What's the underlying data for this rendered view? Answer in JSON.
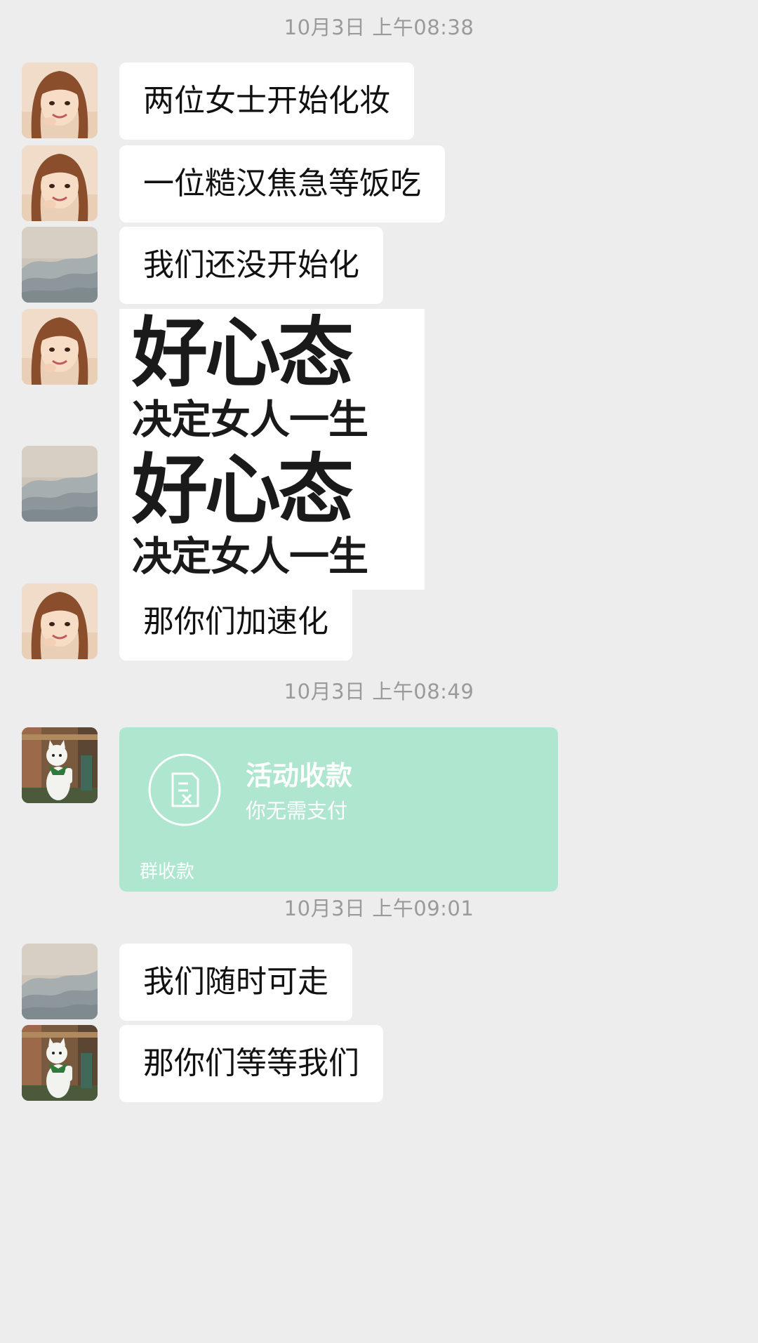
{
  "colors": {
    "background": "#ededed",
    "bubble": "#ffffff",
    "timestamp": "#9a9a9a",
    "payment_card": "#aee6cf"
  },
  "timestamps": [
    "10月3日 上午08:38",
    "10月3日 上午08:49",
    "10月3日 上午09:01"
  ],
  "messages": [
    {
      "sender": "girl-avatar",
      "text": "两位女士开始化妆"
    },
    {
      "sender": "girl-avatar",
      "text": "一位糙汉焦急等饭吃"
    },
    {
      "sender": "mountain-avatar",
      "text": "我们还没开始化"
    },
    {
      "sender": "girl-avatar",
      "sticker_big": "好心态",
      "sticker_small": "决定女人一生"
    },
    {
      "sender": "mountain-avatar",
      "sticker_big": "好心态",
      "sticker_small": "决定女人一生"
    },
    {
      "sender": "girl-avatar",
      "text": "那你们加速化"
    },
    {
      "sender": "cat-avatar",
      "payment": {
        "icon": "receipt-icon",
        "title": "活动收款",
        "subtitle": "你无需支付",
        "footer": "群收款"
      }
    },
    {
      "sender": "mountain-avatar",
      "text": "我们随时可走"
    },
    {
      "sender": "cat-avatar",
      "text": "那你们等等我们"
    }
  ]
}
